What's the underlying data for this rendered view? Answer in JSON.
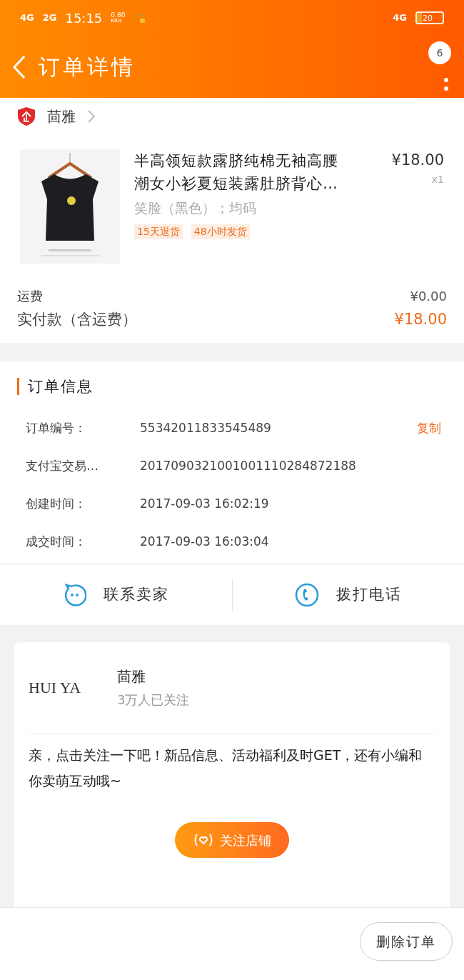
{
  "status_bar": {
    "network_1": "4G",
    "network_2": "2G",
    "time": "15:15",
    "speed": "0.80",
    "speed_unit": "KB/s",
    "network_3": "4G",
    "battery": "20"
  },
  "header": {
    "title": "订单详情",
    "badge": "6"
  },
  "shop": {
    "name": "茴雅"
  },
  "product": {
    "title": "半高领短款露脐纯棉无袖高腰潮女小衫夏短装露肚脐背心…",
    "price": "¥18.00",
    "quantity": "x1",
    "variant": "笑脸（黑色）；均码",
    "tags": [
      "15天退货",
      "48小时发货"
    ]
  },
  "fees": [
    {
      "kind": "plain",
      "label": "运费",
      "value": "¥0.00"
    },
    {
      "kind": "total",
      "label": "实付款（含运费）",
      "value": "¥18.00"
    }
  ],
  "order_info": {
    "title": "订单信息",
    "rows": [
      {
        "label": "订单编号：",
        "value": "55342011833545489",
        "action": "复制"
      },
      {
        "label": "支付宝交易…",
        "value": "2017090321001001110284872188"
      },
      {
        "label": "创建时间：",
        "value": "2017-09-03 16:02:19"
      },
      {
        "label": "成交时间：",
        "value": "2017-09-03 16:03:04"
      }
    ]
  },
  "contact": [
    {
      "kind": "chat",
      "label": "联系卖家"
    },
    {
      "kind": "phone",
      "label": "拨打电话"
    }
  ],
  "follow_card": {
    "logo": "HUI YA",
    "name": "茴雅",
    "followers": "3万人已关注",
    "message": "亲，点击关注一下吧！新品信息、活动福利及时GET，还有小编和你卖萌互动哦~",
    "button": "关注店铺"
  },
  "footer": {
    "button": "删除订单"
  }
}
